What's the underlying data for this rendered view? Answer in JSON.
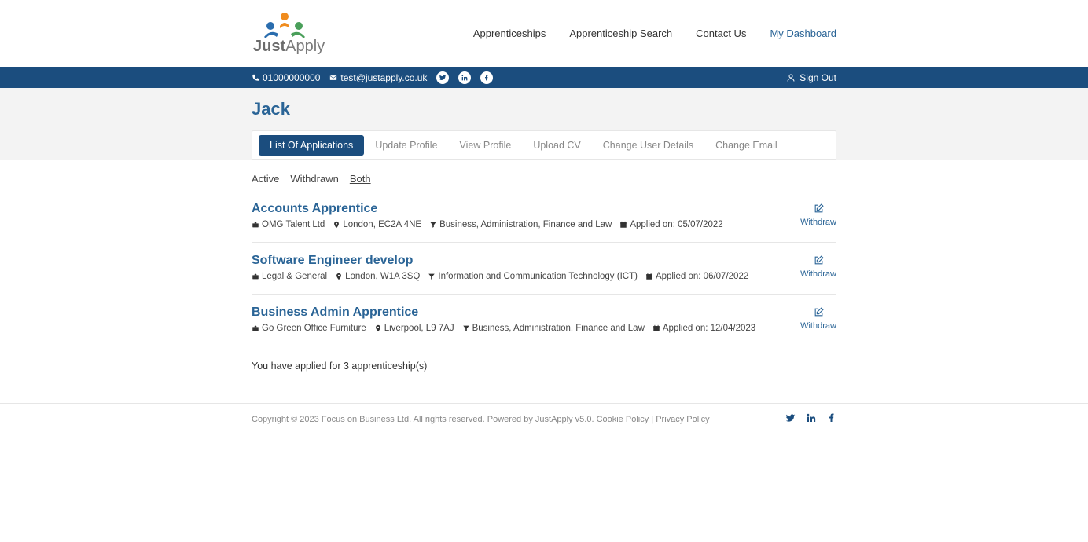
{
  "logo": {
    "text1": "Just",
    "text2": "Apply"
  },
  "nav": {
    "items": [
      {
        "label": "Apprenticeships",
        "active": false
      },
      {
        "label": "Apprenticeship Search",
        "active": false
      },
      {
        "label": "Contact Us",
        "active": false
      },
      {
        "label": "My Dashboard",
        "active": true
      }
    ]
  },
  "contactBar": {
    "phone": "01000000000",
    "email": "test@justapply.co.uk",
    "signout": "Sign Out"
  },
  "page": {
    "title": "Jack"
  },
  "tabs": [
    {
      "label": "List Of Applications",
      "active": true
    },
    {
      "label": "Update Profile"
    },
    {
      "label": "View Profile"
    },
    {
      "label": "Upload CV"
    },
    {
      "label": "Change User Details"
    },
    {
      "label": "Change Email"
    }
  ],
  "filters": {
    "active": "Active",
    "withdrawn": "Withdrawn",
    "both": "Both"
  },
  "applications": [
    {
      "title": "Accounts Apprentice",
      "company": "OMG Talent Ltd",
      "location": "London, EC2A 4NE",
      "category": "Business, Administration, Finance and Law",
      "applied": "Applied on: 05/07/2022",
      "action": "Withdraw"
    },
    {
      "title": "Software Engineer develop",
      "company": "Legal & General",
      "location": "London, W1A 3SQ",
      "category": "Information and Communication Technology (ICT)",
      "applied": "Applied on: 06/07/2022",
      "action": "Withdraw"
    },
    {
      "title": "Business Admin Apprentice",
      "company": "Go Green Office Furniture",
      "location": "Liverpool, L9 7AJ",
      "category": "Business, Administration, Finance and Law",
      "applied": "Applied on: 12/04/2023",
      "action": "Withdraw"
    }
  ],
  "summary": "You have applied for 3 apprenticeship(s)",
  "footer": {
    "copyright": "Copyright © 2023 Focus on Business Ltd. All rights reserved. Powered by JustApply v5.0. ",
    "cookie": "Cookie Policy ",
    "sep": " | ",
    "privacy": "Privacy Policy"
  }
}
